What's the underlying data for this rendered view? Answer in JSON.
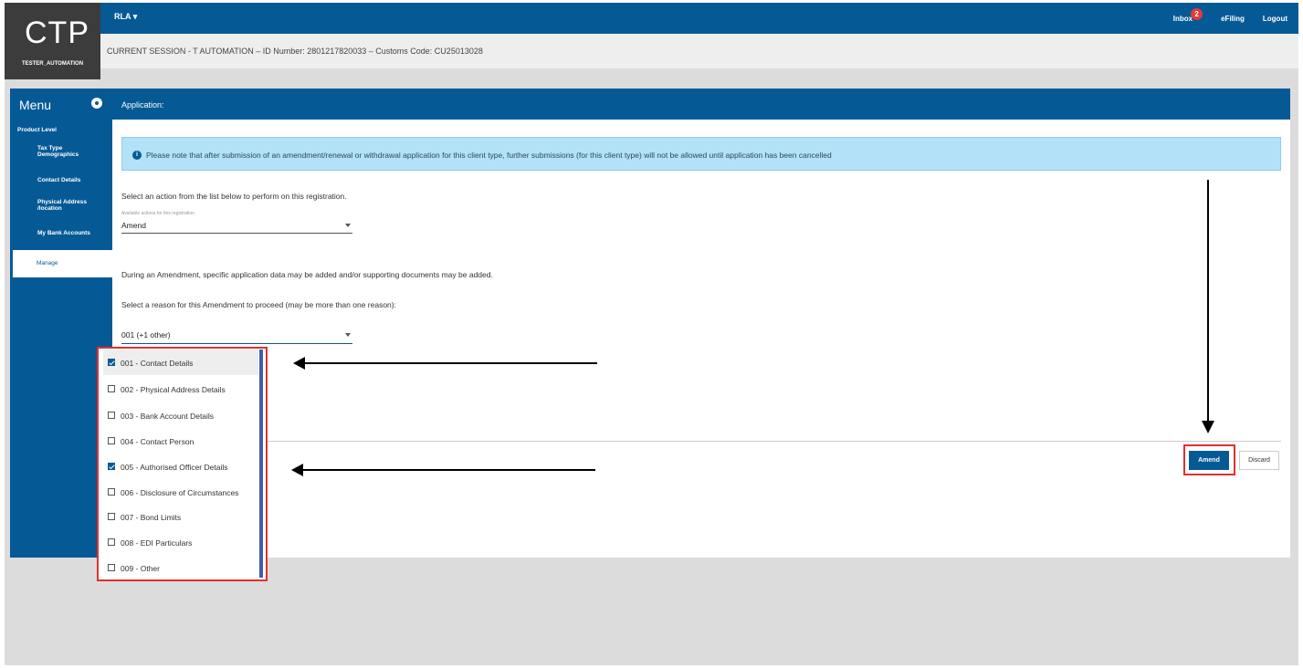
{
  "header": {
    "logo": "CTP",
    "user": "TESTER_AUTOMATION",
    "rla_label": "RLA",
    "inbox_label": "Inbox",
    "inbox_count": "2",
    "efiling_label": "eFiling",
    "logout_label": "Logout",
    "session_text": "CURRENT SESSION - T AUTOMATION – ID Number: 2801217820033 – Customs Code: CU25013028"
  },
  "menu": {
    "title": "Menu",
    "product_level": "Product Level",
    "items": [
      "Tax Type Demographics",
      "Contact Details",
      "Physical Address /location",
      "My Bank Accounts",
      "Manage"
    ]
  },
  "application": {
    "header": "Application:",
    "notice": "Please note that after submission of an amendment/renewal or withdrawal application for this client type, further submissions (for this client type) will not be allowed until application has been cancelled",
    "select_action_text": "Select an action from the list below to perform on this registration.",
    "available_actions_label": "Available actions for this registration",
    "action_value": "Amend",
    "amend_info": "During an Amendment, specific application data may be added and/or supporting documents may be added.",
    "reason_prompt": "Select a reason for this Amendment to proceed (may be more than one reason):",
    "reason_value": "001 (+1 other)",
    "reasons": [
      {
        "label": "001 - Contact Details",
        "checked": true
      },
      {
        "label": "002 - Physical Address Details",
        "checked": false
      },
      {
        "label": "003 - Bank Account Details",
        "checked": false
      },
      {
        "label": "004 - Contact Person",
        "checked": false
      },
      {
        "label": "005 - Authorised Officer Details",
        "checked": true
      },
      {
        "label": "006 - Disclosure of Circumstances",
        "checked": false
      },
      {
        "label": "007 - Bond Limits",
        "checked": false
      },
      {
        "label": "008 - EDI Particulars",
        "checked": false
      },
      {
        "label": "009 - Other",
        "checked": false
      }
    ],
    "amend_button": "Amend",
    "discard_button": "Discard"
  }
}
